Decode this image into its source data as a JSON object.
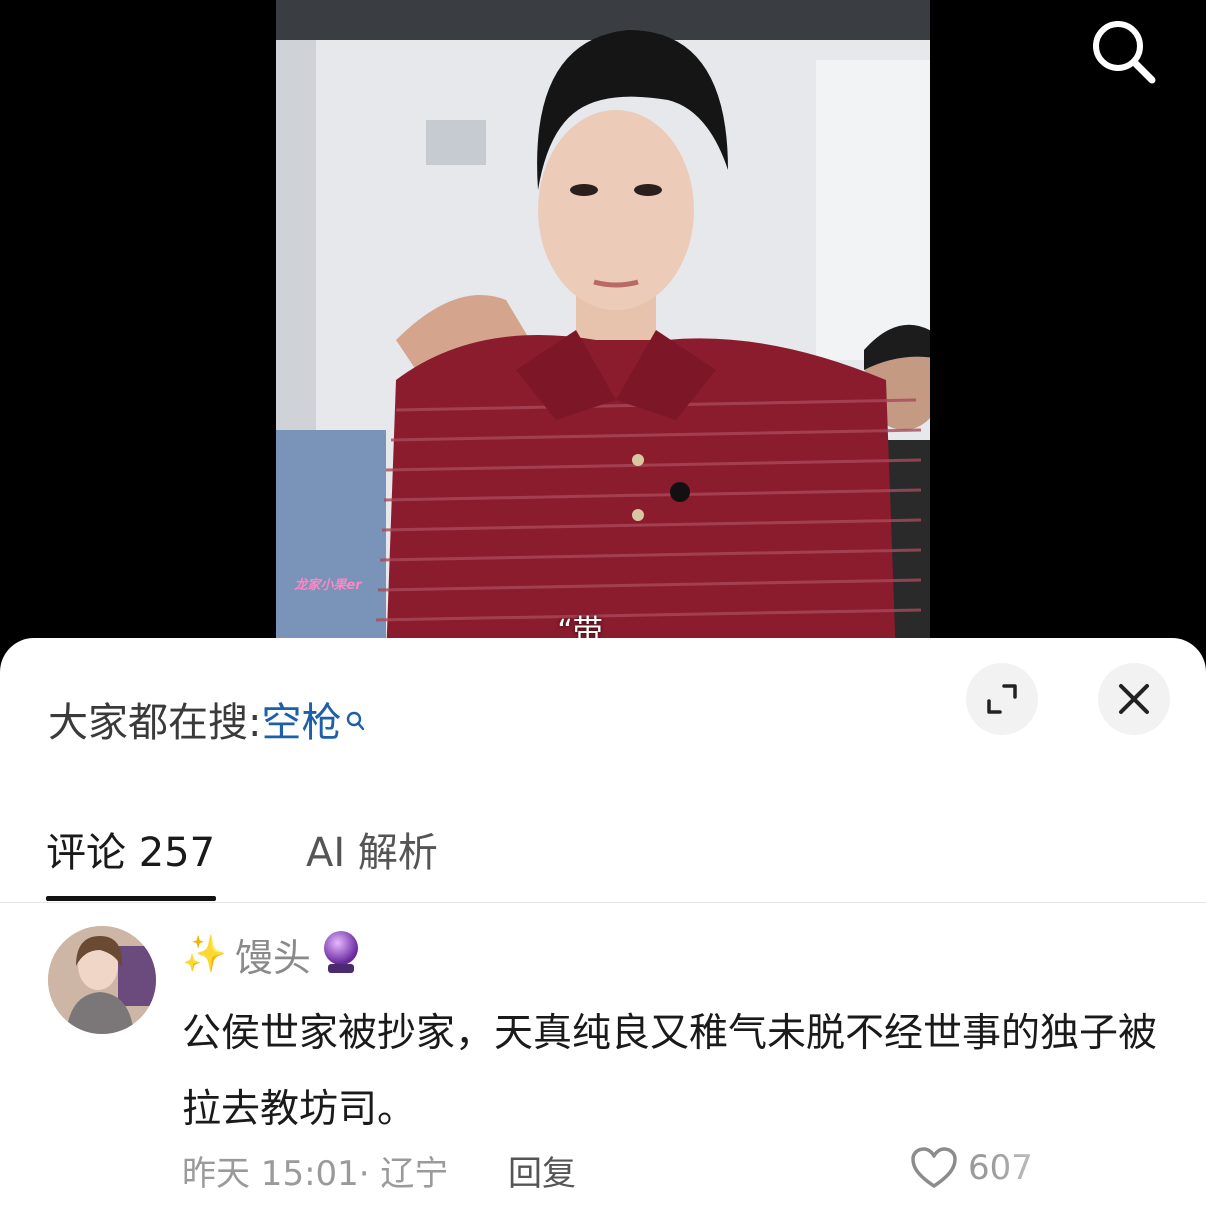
{
  "video": {
    "watermark": "龙家小果er",
    "subtitle": "“带走！”"
  },
  "sheet": {
    "search_hint": {
      "prefix": "大家都在搜:",
      "term": "空枪"
    },
    "tabs": [
      {
        "label": "评论 257",
        "active": true
      },
      {
        "label": "AI 解析",
        "active": false
      }
    ],
    "comments": [
      {
        "username": "馒头",
        "text": "公侯世家被抄家，天真纯良又稚气未脱不经世事的独子被拉去教坊司。",
        "meta": "昨天 15:01· 辽宁",
        "reply_label": "回复",
        "likes": "607"
      }
    ]
  },
  "colors": {
    "accent_link": "#1d5fa8",
    "shirt": "#8b1c2e",
    "background": "#000000"
  }
}
